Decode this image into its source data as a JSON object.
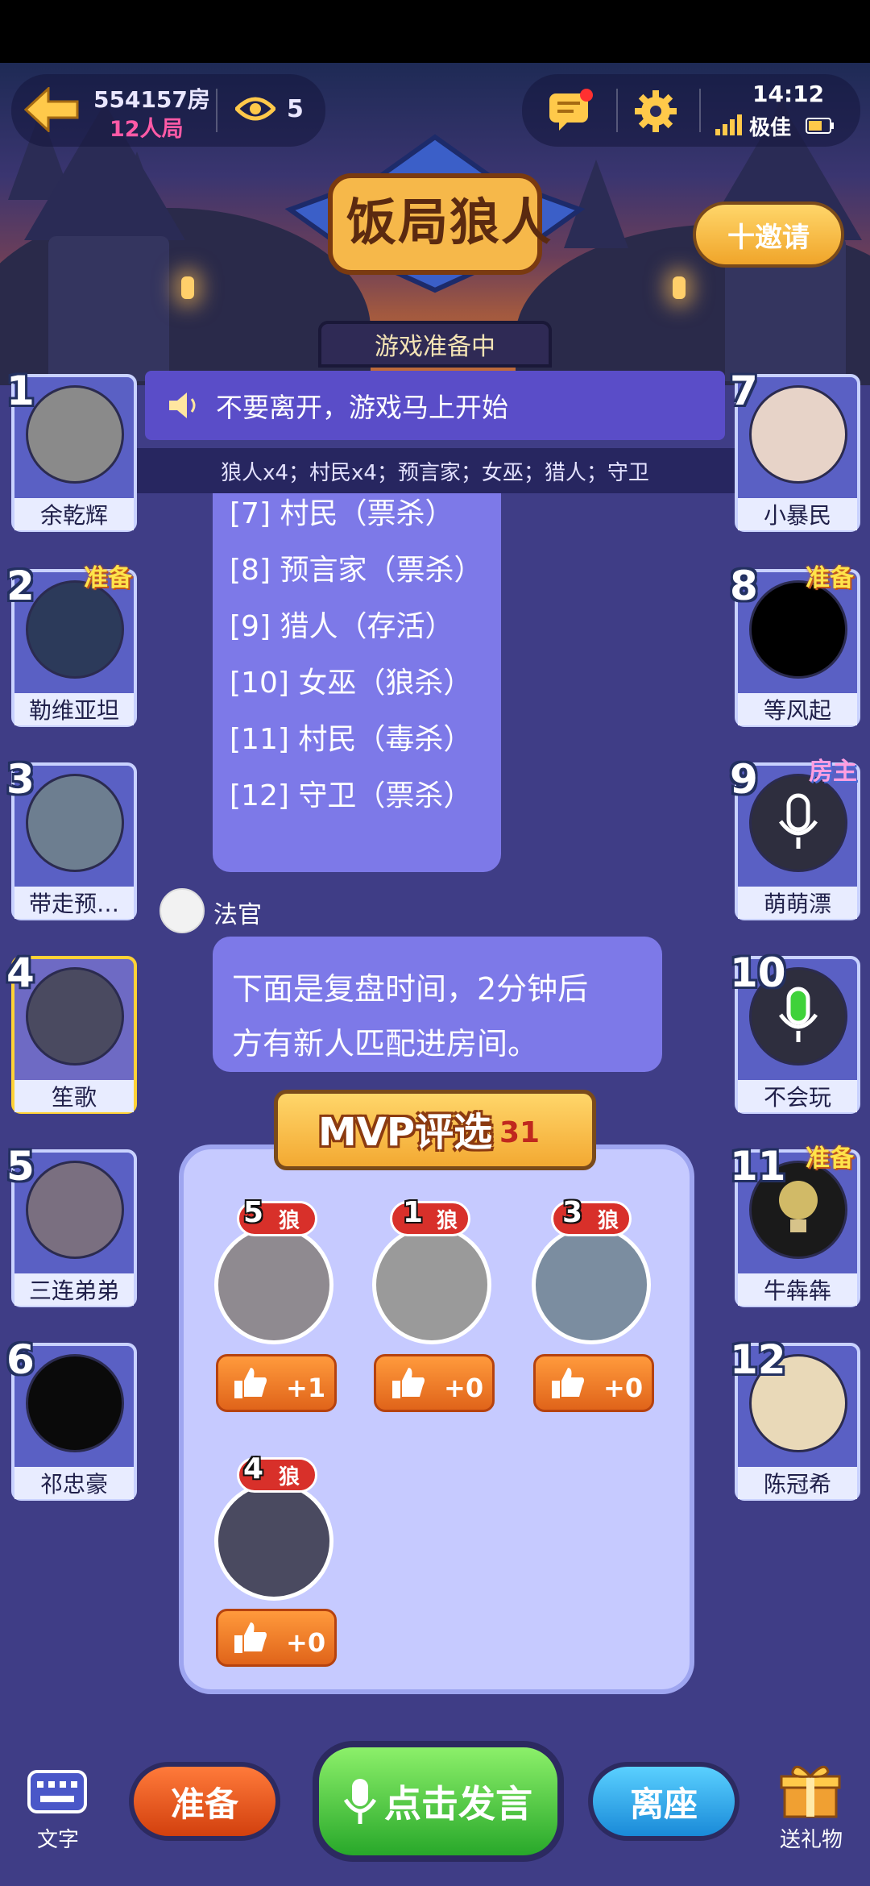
{
  "header": {
    "room_number": "554157房",
    "room_mode": "12人局",
    "viewers": "5",
    "clock": "14:12",
    "signal": "极佳"
  },
  "logo": {
    "title": "饭局狼人"
  },
  "invite_label": "十邀请",
  "game_status": "游戏准备中",
  "announcement": "不要离开，游戏马上开始",
  "roles_line": "狼人x4；村民x4；预言家；女巫；猎人；守卫",
  "results": [
    "[7] 村民（票杀）",
    "[8] 预言家（票杀）",
    "[9] 猎人（存活）",
    "[10] 女巫（狼杀）",
    "[11] 村民（毒杀）",
    "[12] 守卫（票杀）"
  ],
  "judge": {
    "name": "法官",
    "message_line1": "下面是复盘时间，2分钟后",
    "message_line2": "方有新人匹配进房间。"
  },
  "players_left": [
    {
      "num": "1",
      "name": "余乾辉",
      "tag": ""
    },
    {
      "num": "2",
      "name": "勒维亚坦",
      "tag": "准备"
    },
    {
      "num": "3",
      "name": "带走预…",
      "tag": ""
    },
    {
      "num": "4",
      "name": "笙歌",
      "tag": ""
    },
    {
      "num": "5",
      "name": "三连弟弟",
      "tag": ""
    },
    {
      "num": "6",
      "name": "祁忠豪",
      "tag": ""
    }
  ],
  "players_right": [
    {
      "num": "7",
      "name": "小暴民",
      "tag": ""
    },
    {
      "num": "8",
      "name": "等风起",
      "tag": "准备"
    },
    {
      "num": "9",
      "name": "萌萌漂",
      "tag": "房主"
    },
    {
      "num": "10",
      "name": "不会玩",
      "tag": ""
    },
    {
      "num": "11",
      "name": "牛犇犇",
      "tag": "准备"
    },
    {
      "num": "12",
      "name": "陈冠希",
      "tag": ""
    }
  ],
  "mvp": {
    "title": "MVP评选",
    "countdown": "31",
    "candidates": [
      {
        "num": "5",
        "role": "狼",
        "votes": "+1"
      },
      {
        "num": "1",
        "role": "狼",
        "votes": "+0"
      },
      {
        "num": "3",
        "role": "狼",
        "votes": "+0"
      },
      {
        "num": "4",
        "role": "狼",
        "votes": "+0"
      }
    ]
  },
  "bottom": {
    "text_label": "文字",
    "ready_label": "准备",
    "speak_label": "点击发言",
    "leave_label": "离座",
    "gift_label": "送礼物"
  },
  "colors": {
    "ready_tag": "#ffe34a",
    "host_tag": "#ff9ee0",
    "speak_button": "#3fc43a",
    "ready_button": "#e0521a",
    "leave_button": "#2ea8ea"
  }
}
